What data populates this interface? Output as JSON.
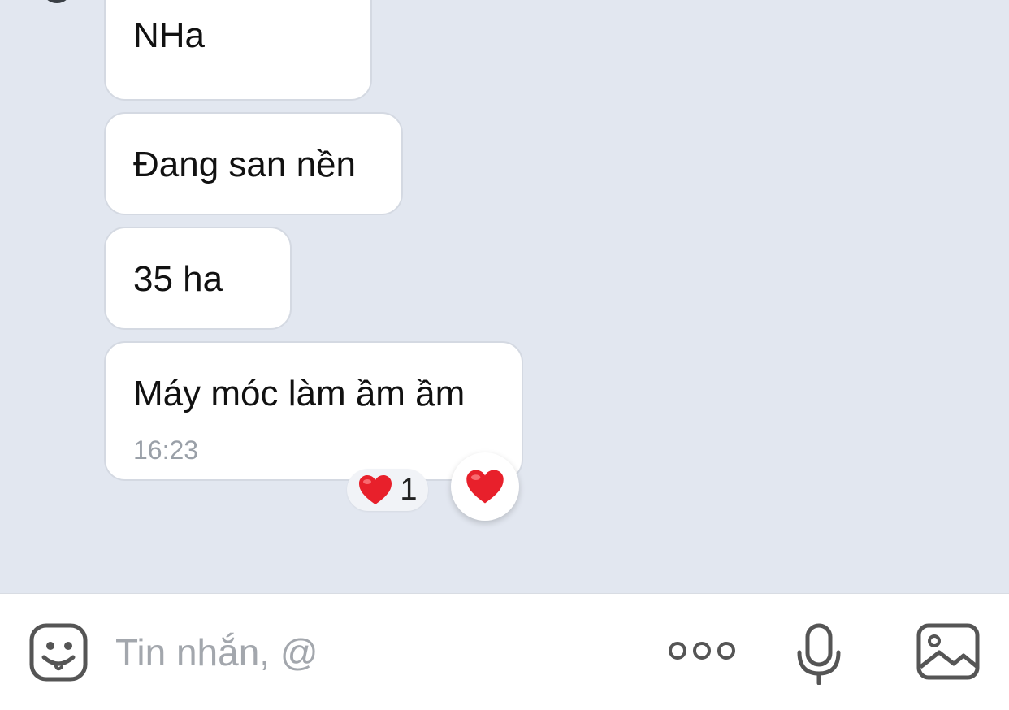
{
  "messages": [
    {
      "text": "NHa"
    },
    {
      "text": "Đang san nền"
    },
    {
      "text": "35 ha"
    },
    {
      "text": "Máy móc làm ầm ầm",
      "time": "16:23"
    }
  ],
  "reactions": {
    "summary_emoji": "❤️",
    "summary_count": "1",
    "react_button_emoji": "❤️"
  },
  "input_bar": {
    "placeholder": "Tin nhắn, @",
    "value": "",
    "icons": [
      "emoji-icon",
      "more-icon",
      "mic-icon",
      "image-icon"
    ]
  },
  "colors": {
    "chat_background": "#e2e7f0",
    "bubble": "#ffffff",
    "heart": "#e8202b",
    "icon": "#555555",
    "placeholder": "#a3a7ad"
  }
}
